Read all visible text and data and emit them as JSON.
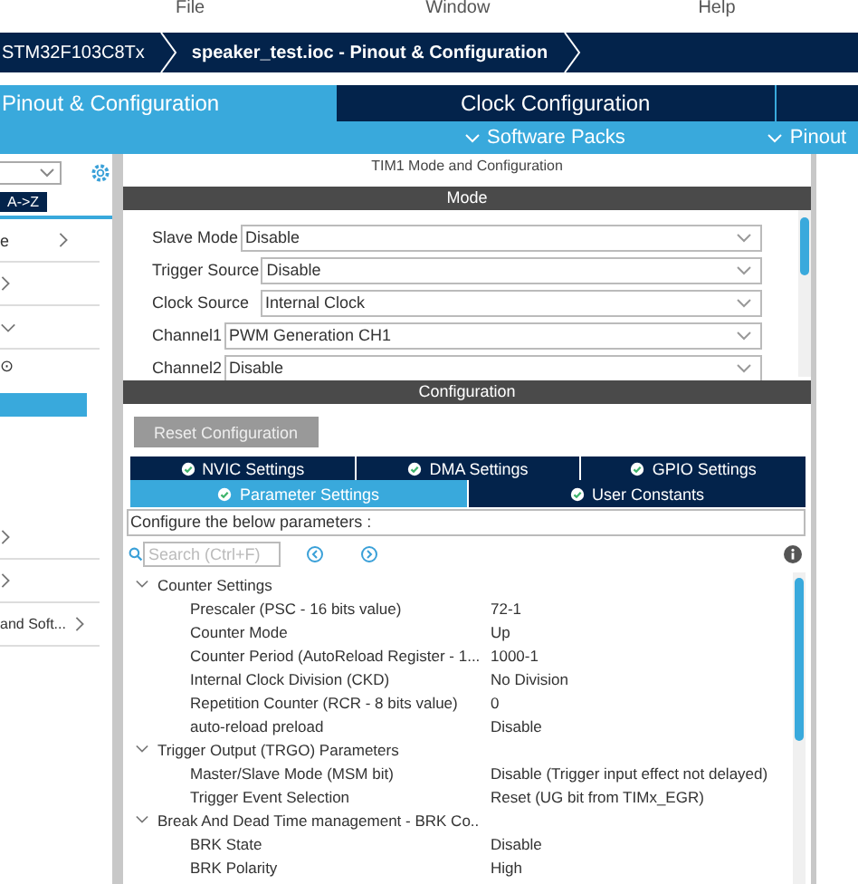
{
  "menu": [
    "File",
    "Window",
    "Help"
  ],
  "breadcrumbs": [
    {
      "label": "STM32F103C8Tx",
      "selected": false
    },
    {
      "label": "speaker_test.ioc - Pinout & Configuration",
      "selected": true
    }
  ],
  "main_tabs": [
    {
      "label": "Pinout & Configuration",
      "selected": true
    },
    {
      "label": "Clock Configuration",
      "selected": false
    },
    {
      "selected": false
    }
  ],
  "sub_menu": [
    "Software Packs",
    "Pinout"
  ],
  "left_panel": {
    "sort_button": "A->Z",
    "items": [
      {
        "label": "e",
        "expanded": false,
        "selected": false
      },
      {
        "expanded": false,
        "selected": false
      },
      {
        "expanded": true,
        "selected": false
      },
      {
        "label": "⊙",
        "selected": false
      },
      {
        "selected": true
      },
      {
        "expanded": false,
        "selected": false
      },
      {
        "expanded": false,
        "selected": false
      },
      {
        "label": "and Soft...",
        "expanded": false,
        "selected": false
      }
    ]
  },
  "panel": {
    "title": "TIM1 Mode and Configuration",
    "mode_header": "Mode",
    "mode_fields": [
      {
        "label": "Slave Mode",
        "value": "Disable"
      },
      {
        "label": "Trigger Source",
        "value": "Disable"
      },
      {
        "label": "Clock Source",
        "value": "Internal Clock"
      },
      {
        "label": "Channel1",
        "value": "PWM Generation CH1"
      },
      {
        "label": "Channel2",
        "value": "Disable"
      }
    ],
    "config_header": "Configuration",
    "reset_button": "Reset Configuration",
    "tab_rows": [
      [
        {
          "label": "NVIC Settings",
          "selected": false
        },
        {
          "label": "DMA Settings",
          "selected": false
        },
        {
          "label": "GPIO Settings",
          "selected": false
        }
      ],
      [
        {
          "label": "Parameter Settings",
          "selected": true
        },
        {
          "label": "User Constants",
          "selected": false
        }
      ]
    ],
    "hint": "Configure the below parameters :",
    "search": {
      "placeholder": "Search (Ctrl+F)"
    },
    "groups": [
      {
        "label": "Counter Settings",
        "expanded": true,
        "children": [
          {
            "label": "Prescaler (PSC - 16 bits value)",
            "value": "72-1"
          },
          {
            "label": "Counter Mode",
            "value": "Up"
          },
          {
            "label": "Counter Period (AutoReload Register - 1...",
            "value": "1000-1"
          },
          {
            "label": "Internal Clock Division (CKD)",
            "value": "No Division"
          },
          {
            "label": "Repetition Counter (RCR - 8 bits value)",
            "value": "0"
          },
          {
            "label": "auto-reload preload",
            "value": "Disable"
          }
        ]
      },
      {
        "label": "Trigger Output (TRGO) Parameters",
        "expanded": true,
        "children": [
          {
            "label": "Master/Slave Mode (MSM bit)",
            "value": "Disable (Trigger input effect not delayed)"
          },
          {
            "label": "Trigger Event Selection",
            "value": "Reset (UG bit from TIMx_EGR)"
          }
        ]
      },
      {
        "label": "Break And Dead Time management - BRK Co..",
        "expanded": true,
        "children": [
          {
            "label": "BRK State",
            "value": "Disable"
          },
          {
            "label": "BRK Polarity",
            "value": "High"
          }
        ]
      }
    ]
  }
}
